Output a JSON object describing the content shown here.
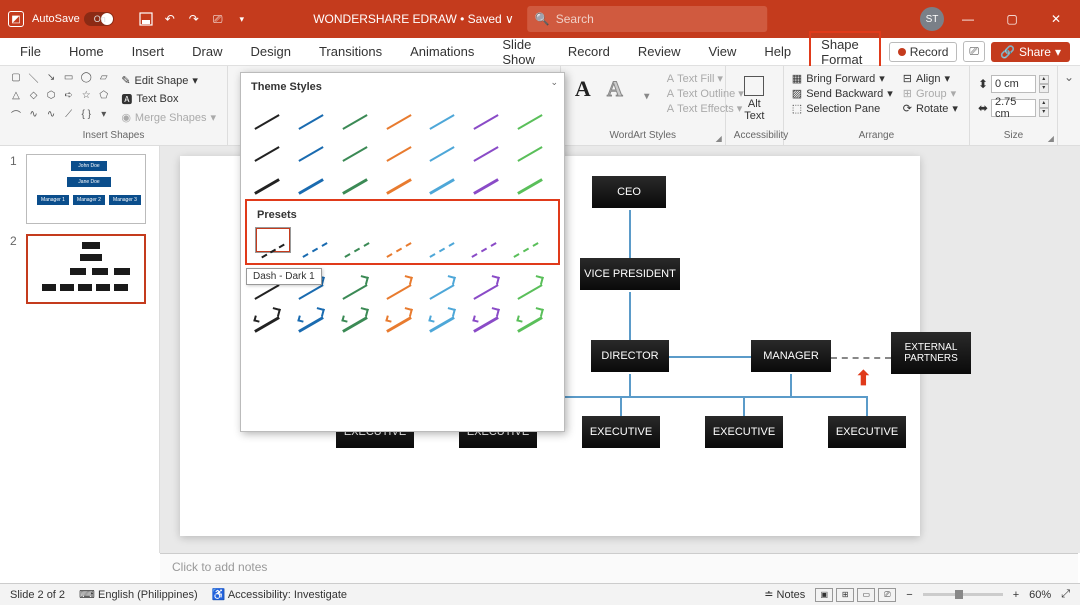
{
  "titlebar": {
    "autosave_label": "AutoSave",
    "autosave_state": "On",
    "doc_title": "WONDERSHARE EDRAW • Saved ∨",
    "search_placeholder": "Search",
    "user_initials": "ST"
  },
  "tabs": {
    "file": "File",
    "home": "Home",
    "insert": "Insert",
    "draw": "Draw",
    "design": "Design",
    "transitions": "Transitions",
    "animations": "Animations",
    "slideshow": "Slide Show",
    "record": "Record",
    "review": "Review",
    "view": "View",
    "help": "Help",
    "shape_format": "Shape Format",
    "record_btn": "Record",
    "share_btn": "Share"
  },
  "ribbon": {
    "insert_shapes_label": "Insert Shapes",
    "edit_shape": "Edit Shape",
    "text_box": "Text Box",
    "merge_shapes": "Merge Shapes",
    "wordart_label": "WordArt Styles",
    "text_fill": "Text Fill",
    "text_outline": "Text Outline",
    "text_effects": "Text Effects",
    "accessibility_label": "Accessibility",
    "alt_text": "Alt\nText",
    "arrange_label": "Arrange",
    "bring_forward": "Bring Forward",
    "send_backward": "Send Backward",
    "selection_pane": "Selection Pane",
    "align": "Align",
    "group": "Group",
    "rotate": "Rotate",
    "size_label": "Size",
    "height": "0 cm",
    "width": "2.75 cm"
  },
  "dropdown": {
    "theme_styles": "Theme Styles",
    "presets": "Presets",
    "tooltip": "Dash - Dark 1",
    "colors": [
      "#222",
      "#1a6bb0",
      "#3b8a55",
      "#e87b2f",
      "#4ea7d8",
      "#8a4bc7",
      "#5abf5a"
    ]
  },
  "thumbs": {
    "slide1_boxes": [
      "John Doe",
      "Jane Doe",
      "Manager 1",
      "Manager 2",
      "Manager 3"
    ],
    "slide2_num": "2",
    "slide1_num": "1"
  },
  "org": {
    "ceo": "CEO",
    "vp": "VICE PRESIDENT",
    "director": "DIRECTOR",
    "manager": "MANAGER",
    "external": "EXTERNAL PARTNERS",
    "exec": "EXECUTIVE"
  },
  "notes_placeholder": "Click to add notes",
  "statusbar": {
    "slide_info": "Slide 2 of 2",
    "language": "English (Philippines)",
    "accessibility": "Accessibility: Investigate",
    "notes_btn": "Notes",
    "zoom": "60%"
  }
}
